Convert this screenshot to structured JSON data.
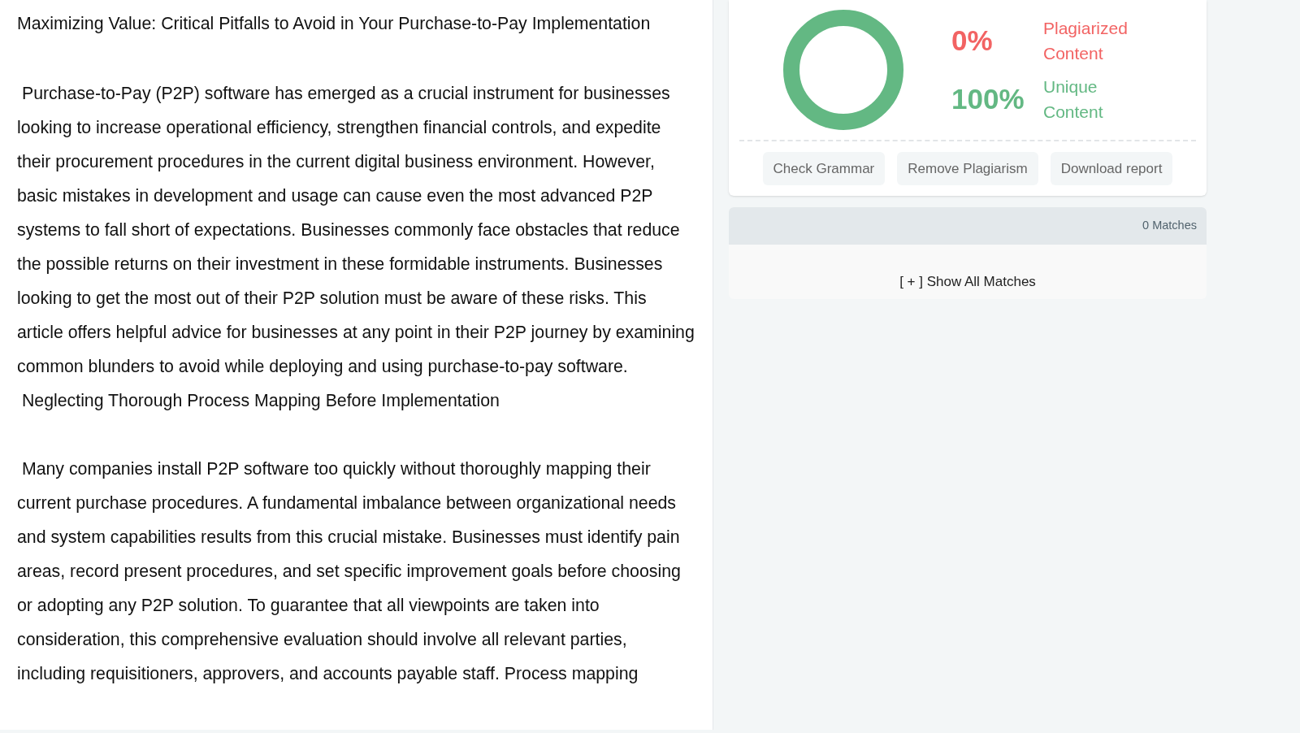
{
  "document": {
    "title": "Maximizing Value: Critical Pitfalls to Avoid in Your Purchase-to-Pay Implementation",
    "blocks": [
      {
        "kind": "paragraph",
        "text": " Purchase-to-Pay (P2P) software has emerged as a crucial instrument for businesses looking to increase operational efficiency, strengthen financial controls, and expedite their procurement procedures in the current digital business environment. However, basic mistakes in development and usage can cause even the most advanced P2P systems to fall short of expectations. Businesses commonly face obstacles that reduce the possible returns on their investment in these formidable instruments. Businesses looking to get the most out of their P2P solution must be aware of these risks. This article offers helpful advice for businesses at any point in their P2P journey by examining common blunders to avoid while deploying and using purchase-to-pay software."
      },
      {
        "kind": "heading",
        "text": " Neglecting Thorough Process Mapping Before Implementation"
      },
      {
        "kind": "paragraph",
        "text": " Many companies install P2P software too quickly without thoroughly mapping their current purchase procedures. A fundamental imbalance between organizational needs and system capabilities results from this crucial mistake. Businesses must identify pain areas, record present procedures, and set specific improvement goals before choosing or adopting any P2P solution. To guarantee that all viewpoints are taken into consideration, this comprehensive evaluation should involve all relevant parties, including requisitioners, approvers, and accounts payable staff. Process mapping"
      }
    ]
  },
  "report": {
    "stats": [
      {
        "kind": "plagiarized",
        "value": "0%",
        "label": "Plagiarized Content",
        "color": "#f26363"
      },
      {
        "kind": "unique",
        "value": "100%",
        "label": "Unique Content",
        "color": "#63b883"
      }
    ],
    "buttons": [
      "Check Grammar",
      "Remove Plagiarism",
      "Download report"
    ]
  },
  "matches": {
    "count": "0 Matches",
    "toggle": "[ + ] Show All Matches"
  }
}
